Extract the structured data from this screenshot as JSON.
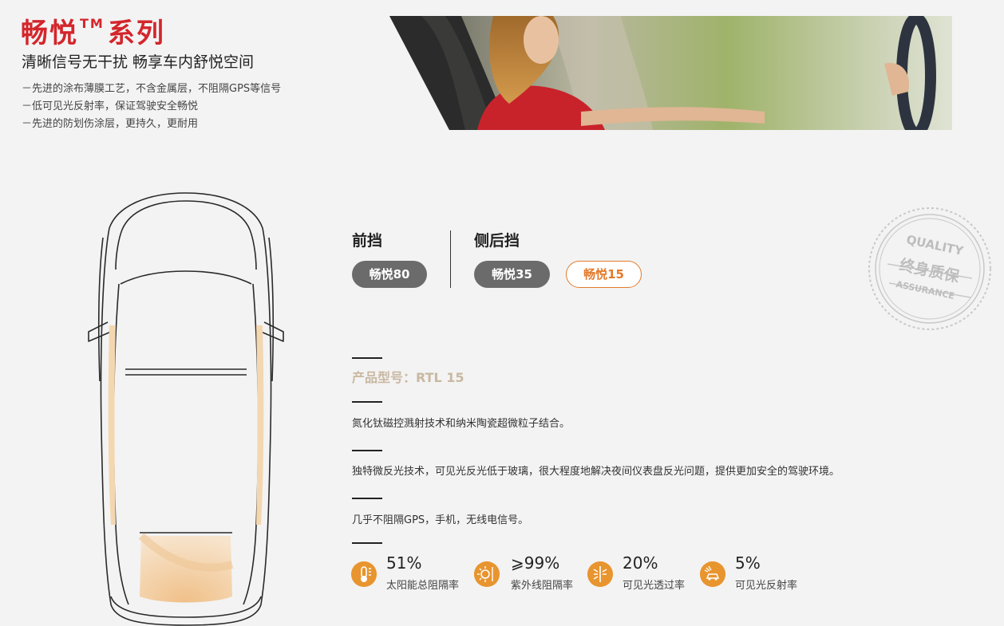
{
  "header": {
    "title": "畅悦",
    "trademark": "TM",
    "title_suffix": "系列",
    "subtitle": "清晰信号无干扰 畅享车内舒悦空间",
    "bullets": [
      "－先进的涂布薄膜工艺，不含金属层，不阻隔GPS等信号",
      "－低可见光反射率，保证驾驶安全畅悦",
      "－先进的防划伤涂层，更持久，更耐用"
    ]
  },
  "tabs": {
    "front_label": "前挡",
    "side_label": "侧后挡",
    "front_options": [
      "畅悦80"
    ],
    "side_options": [
      "畅悦35",
      "畅悦15"
    ],
    "selected": "畅悦15"
  },
  "stamp": {
    "top_text": "QUALITY",
    "center_text": "终身质保",
    "bottom_text": "ASSURANCE"
  },
  "product": {
    "model": "产品型号：RTL 15",
    "features": [
      "氮化钛磁控溅射技术和纳米陶瓷超微粒子结合。",
      "独特微反光技术，可见光反光低于玻璃，很大程度地解决夜间仪表盘反光问题，提供更加安全的驾驶环境。",
      "几乎不阻隔GPS，手机，无线电信号。"
    ]
  },
  "stats": [
    {
      "value": "51%",
      "label": "太阳能总阻隔率",
      "icon": "thermometer-icon"
    },
    {
      "value": "⩾99%",
      "label": "紫外线阻隔率",
      "icon": "sun-icon"
    },
    {
      "value": "20%",
      "label": "可见光透过率",
      "icon": "light-icon"
    },
    {
      "value": "5%",
      "label": "可见光反射率",
      "icon": "car-glare-icon"
    }
  ],
  "colors": {
    "brand_red": "#d3262c",
    "accent_orange": "#e37a2a",
    "icon_orange": "#e8952f",
    "pill_gray": "#6b6b6b",
    "model_beige": "#c9b8a2"
  }
}
